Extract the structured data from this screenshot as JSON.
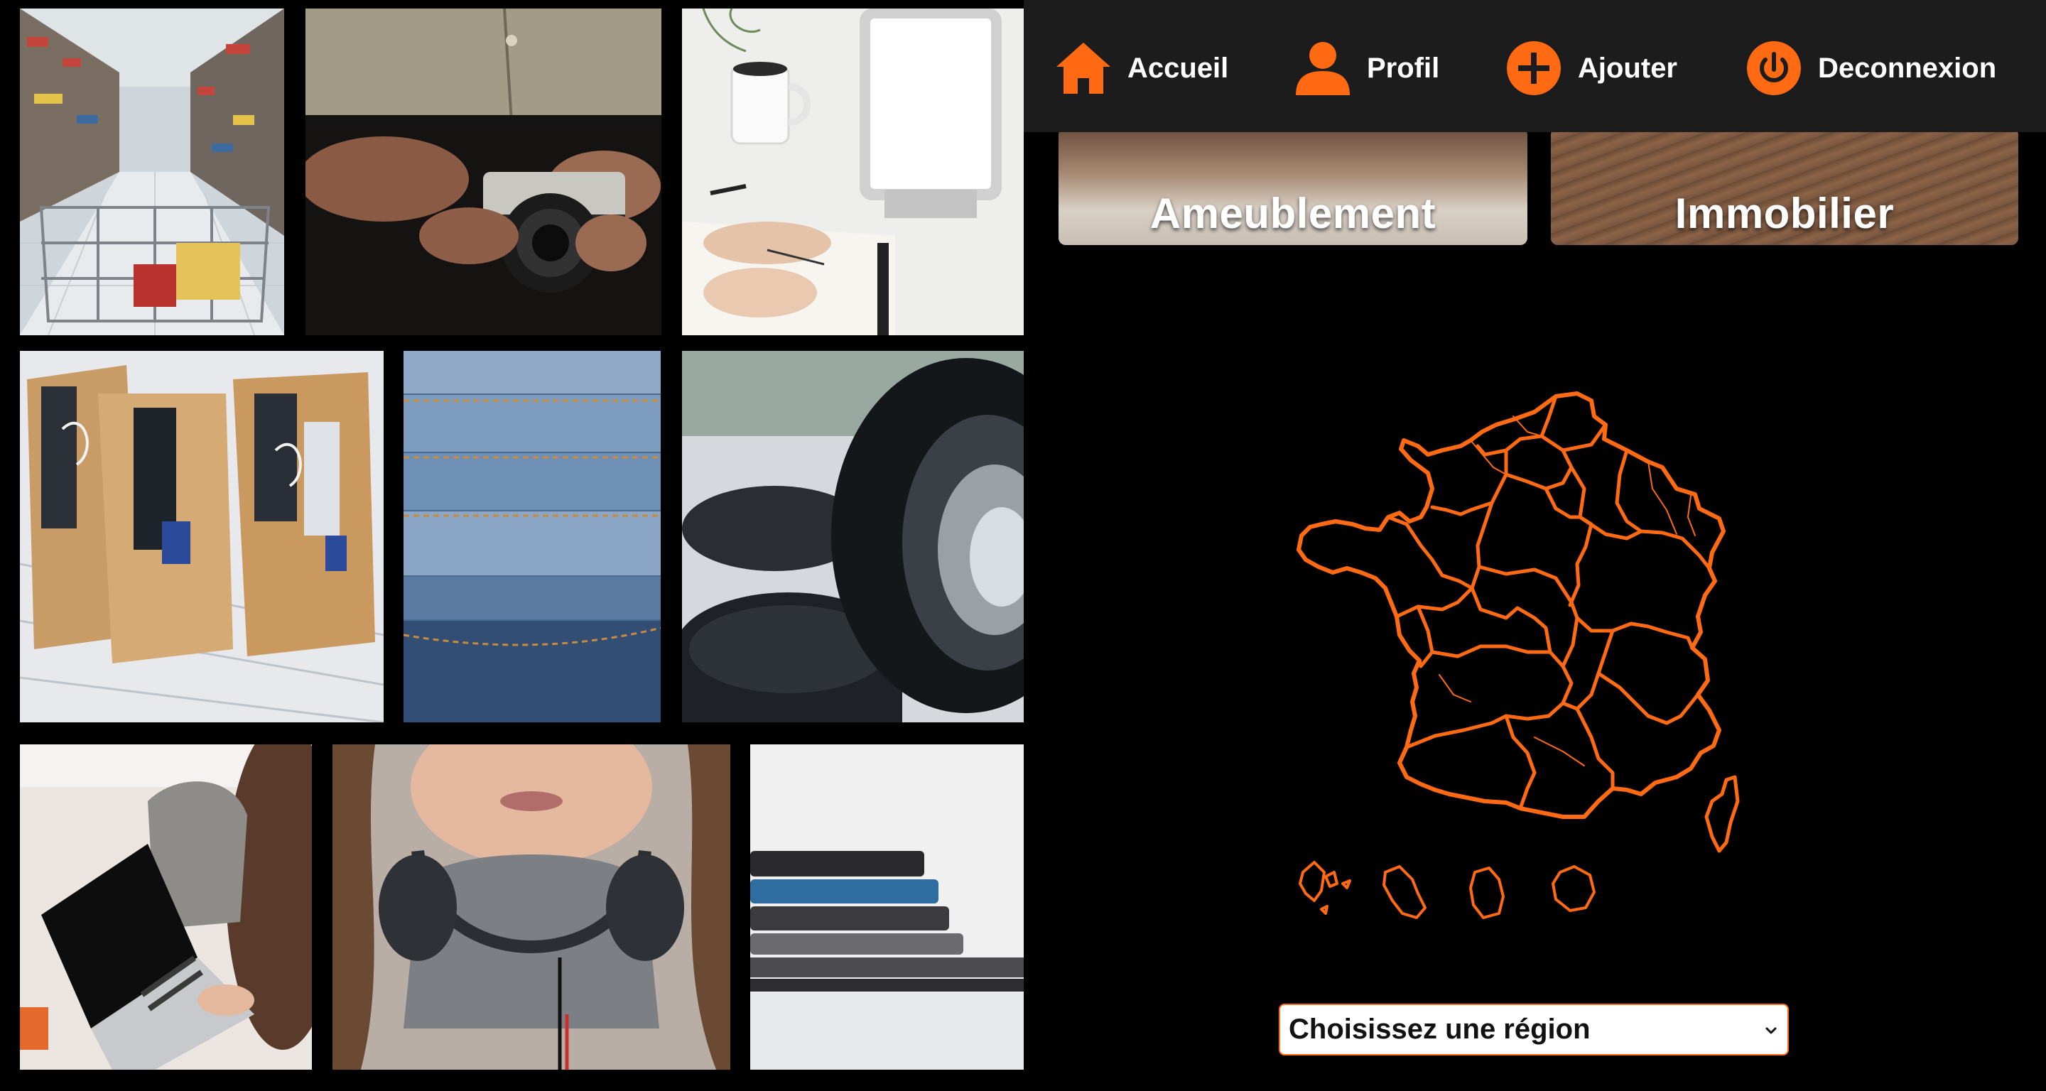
{
  "nav": {
    "items": [
      {
        "label": "Accueil",
        "icon": "home-icon"
      },
      {
        "label": "Profil",
        "icon": "user-icon"
      },
      {
        "label": "Ajouter",
        "icon": "plus-circle-icon"
      },
      {
        "label": "Deconnexion",
        "icon": "power-icon"
      }
    ]
  },
  "categories": [
    {
      "label": "Ameublement"
    },
    {
      "label": "Immobilier"
    }
  ],
  "region_select": {
    "selected": "Choisissez une région"
  },
  "colors": {
    "accent": "#ff6a13",
    "background": "#000000",
    "navbar": "#1c1c1c"
  }
}
